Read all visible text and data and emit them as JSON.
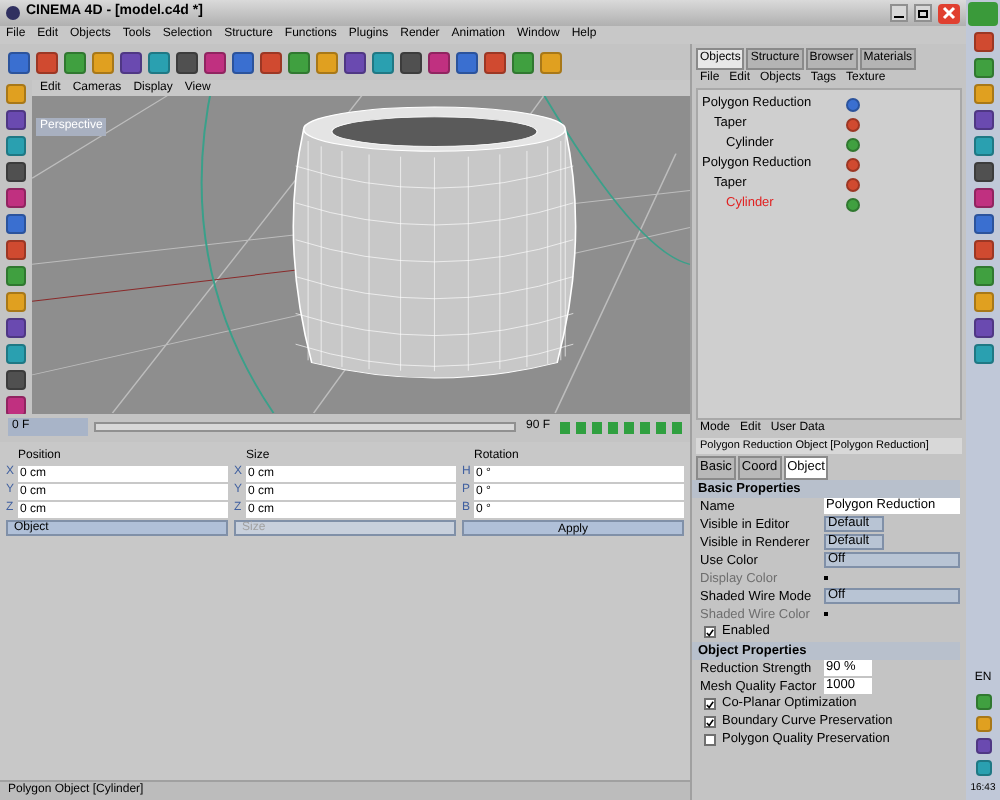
{
  "window": {
    "title": "CINEMA 4D - [model.c4d *]"
  },
  "menu": [
    "File",
    "Edit",
    "Objects",
    "Tools",
    "Selection",
    "Structure",
    "Functions",
    "Plugins",
    "Render",
    "Animation",
    "Window",
    "Help"
  ],
  "viewport": {
    "menu": [
      "Edit",
      "Cameras",
      "Display",
      "View"
    ],
    "label": "Perspective"
  },
  "timeline": {
    "start": "0 F",
    "end": "90 F"
  },
  "object_manager": {
    "tabs": [
      {
        "label": "Objects",
        "selected": true
      },
      {
        "label": "Structure",
        "selected": false
      },
      {
        "label": "Browser",
        "selected": false
      },
      {
        "label": "Materials",
        "selected": false
      }
    ],
    "menu": [
      "File",
      "Edit",
      "Objects",
      "Tags",
      "Texture"
    ],
    "tree": [
      {
        "name": "Polygon Reduction",
        "color": "#000000",
        "children": [
          {
            "name": "Taper",
            "color": "#000000",
            "children": [
              {
                "name": "Cylinder",
                "color": "#000000"
              }
            ]
          }
        ]
      },
      {
        "name": "Polygon Reduction",
        "color": "#000000",
        "children": [
          {
            "name": "Taper",
            "color": "#000000",
            "children": [
              {
                "name": "Cylinder",
                "color": "#e02020"
              }
            ]
          }
        ]
      }
    ]
  },
  "attributes": {
    "menu": [
      "Mode",
      "Edit",
      "User Data"
    ],
    "title": "Polygon Reduction Object [Polygon Reduction]",
    "tabs": [
      {
        "label": "Basic",
        "selected": false
      },
      {
        "label": "Coord",
        "selected": false
      },
      {
        "label": "Object",
        "selected": true
      }
    ],
    "sections": [
      {
        "title": "Basic Properties",
        "rows": [
          {
            "kind": "text",
            "label": "Name",
            "value": "Polygon Reduction",
            "disabled": false
          },
          {
            "kind": "select",
            "label": "Visible in Editor",
            "value": "Default",
            "disabled": false
          },
          {
            "kind": "select",
            "label": "Visible in Renderer",
            "value": "Default",
            "disabled": false
          },
          {
            "kind": "wide",
            "label": "Use Color",
            "value": "Off",
            "disabled": false
          },
          {
            "kind": "color",
            "label": "Display Color",
            "disabled": true
          },
          {
            "kind": "wide",
            "label": "Shaded Wire Mode",
            "value": "Off",
            "disabled": false
          },
          {
            "kind": "color",
            "label": "Shaded Wire Color",
            "disabled": true
          },
          {
            "kind": "check",
            "label": "Enabled",
            "checked": true,
            "disabled": false
          }
        ]
      },
      {
        "title": "Object Properties",
        "rows": [
          {
            "kind": "number",
            "label": "Reduction Strength",
            "value": "90 %",
            "disabled": false
          },
          {
            "kind": "number",
            "label": "Mesh Quality Factor",
            "value": "1000",
            "disabled": false
          },
          {
            "kind": "check",
            "label": "Co-Planar Optimization",
            "checked": true,
            "disabled": false
          },
          {
            "kind": "check",
            "label": "Boundary Curve Preservation",
            "checked": true,
            "disabled": false
          },
          {
            "kind": "check",
            "label": "Polygon Quality Preservation",
            "checked": false,
            "disabled": false
          }
        ]
      }
    ]
  },
  "coordinates": {
    "columns": [
      {
        "header": "Position",
        "fields": [
          {
            "axis": "X",
            "value": "0 cm"
          },
          {
            "axis": "Y",
            "value": "0 cm"
          },
          {
            "axis": "Z",
            "value": "0 cm"
          }
        ]
      },
      {
        "header": "Size",
        "fields": [
          {
            "axis": "X",
            "value": "0 cm"
          },
          {
            "axis": "Y",
            "value": "0 cm"
          },
          {
            "axis": "Z",
            "value": "0 cm"
          }
        ]
      },
      {
        "header": "Rotation",
        "fields": [
          {
            "axis": "H",
            "value": "0 °"
          },
          {
            "axis": "P",
            "value": "0 °"
          },
          {
            "axis": "B",
            "value": "0 °"
          }
        ]
      }
    ],
    "footer": [
      {
        "kind": "select",
        "label": "Object",
        "disabled": false
      },
      {
        "kind": "select",
        "label": "Size",
        "disabled": true
      },
      {
        "kind": "button",
        "label": "Apply",
        "disabled": false
      }
    ]
  },
  "status_bar": "Polygon Object [Cylinder]",
  "taskbar": {
    "language": "EN",
    "clock": "16:43"
  }
}
